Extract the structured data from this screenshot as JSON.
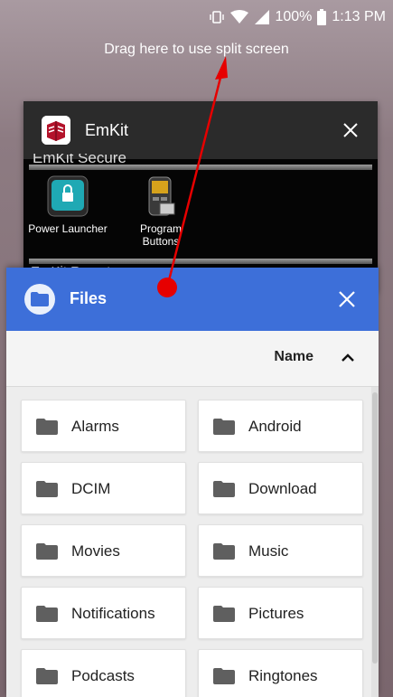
{
  "status_bar": {
    "battery": "100%",
    "time": "1:13 PM",
    "icons": [
      "vibrate-icon",
      "wifi-icon",
      "signal-icon",
      "battery-icon"
    ]
  },
  "split_screen_hint": "Drag here to use split screen",
  "emkit": {
    "title": "EmKit",
    "section_label": "EmKit Secure",
    "section_label_2": "EmKit Remote",
    "apps": [
      {
        "label": "Power Launcher",
        "icon": "power-launcher-icon"
      },
      {
        "label": "Programmable Buttons",
        "line1": "Program",
        "line2": "Buttons",
        "icon": "program-buttons-icon"
      }
    ]
  },
  "files": {
    "title": "Files",
    "sort_label": "Name",
    "folders": [
      {
        "name": "Alarms"
      },
      {
        "name": "Android"
      },
      {
        "name": "DCIM"
      },
      {
        "name": "Download"
      },
      {
        "name": "Movies"
      },
      {
        "name": "Music"
      },
      {
        "name": "Notifications"
      },
      {
        "name": "Pictures"
      },
      {
        "name": "Podcasts"
      },
      {
        "name": "Ringtones"
      }
    ]
  },
  "colors": {
    "files_accent": "#3d6fd9",
    "annotation": "#e60000",
    "emkit_header": "#2b2b2b"
  }
}
